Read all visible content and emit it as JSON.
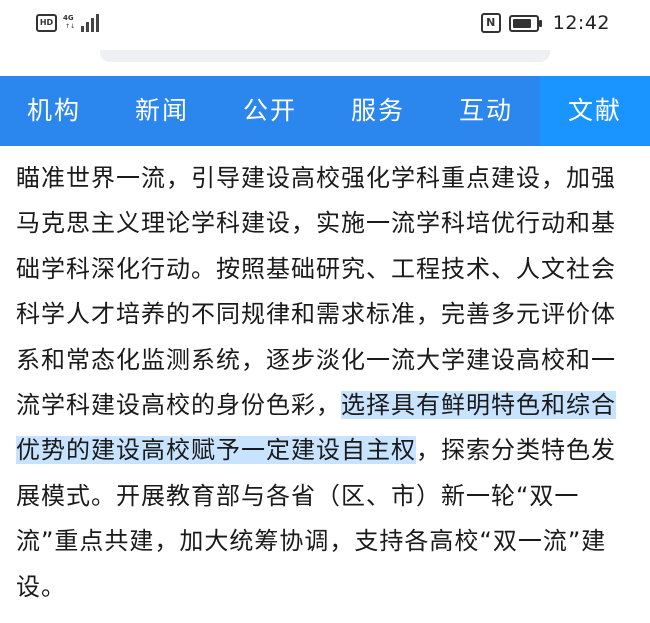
{
  "status_bar": {
    "hd_label": "HD",
    "network_label": "4G",
    "network_sub": "↑↓",
    "nfc_label": "N",
    "time": "12:42"
  },
  "nav": {
    "items": [
      {
        "label": "机构"
      },
      {
        "label": "新闻"
      },
      {
        "label": "公开"
      },
      {
        "label": "服务"
      },
      {
        "label": "互动"
      },
      {
        "label": "文献"
      }
    ],
    "active_index": 5,
    "colors": {
      "bar": "#2b86ee",
      "active": "#1a95ff",
      "text": "#ffffff"
    }
  },
  "article": {
    "text_before": "瞄准世界一流，引导建设高校强化学科重点建设，加强马克思主义理论学科建设，实施一流学科培优行动和基础学科深化行动。按照基础研究、工程技术、人文社会科学人才培养的不同规律和需求标准，完善多元评价体系和常态化监测系统，逐步淡化一流大学建设高校和一流学科建设高校的身份色彩，",
    "text_highlight": "选择具有鲜明特色和综合优势的建设高校赋予一定建设自主权",
    "text_after": "，探索分类特色发展模式。开展教育部与各省（区、市）新一轮“双一流”重点共建，加大统筹协调，支持各高校“双一流”建设。",
    "highlight_color": "#c7e3ff"
  }
}
